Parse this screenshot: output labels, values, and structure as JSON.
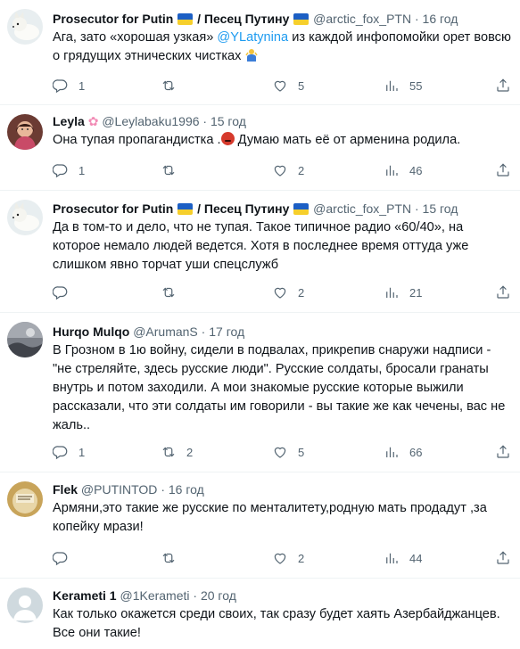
{
  "tweets": [
    {
      "name": "Prosecutor for Putin",
      "name_suffix": "/ Песец Путину",
      "handle": "@arctic_fox_PTN",
      "time": "16 год",
      "text_before": "Ага, зато «хорошая узкая» ",
      "mention": "@YLatynina",
      "text_after": "  из каждой инфопомойки орет вовсю о грядущих этнических чистках",
      "replies": "1",
      "retweets": "",
      "likes": "5",
      "views": "55"
    },
    {
      "name": "Leyla",
      "handle": "@Leylabaku1996",
      "time": "15 год",
      "text_before": "Она тупая пропагандистка .",
      "text_after": " Думаю  мать  её от арменина родила.",
      "replies": "1",
      "retweets": "",
      "likes": "2",
      "views": "46"
    },
    {
      "name": "Prosecutor for Putin",
      "name_suffix": "/ Песец Путину",
      "handle": "@arctic_fox_PTN",
      "time": "15 год",
      "text": "Да в том-то и дело, что не тупая. Такое типичное радио «60/40», на которое немало людей ведется. Хотя в последнее время оттуда уже слишком явно торчат уши спецслужб",
      "replies": "",
      "retweets": "",
      "likes": "2",
      "views": "21"
    },
    {
      "name": "Hurqo Mulqo",
      "handle": "@ArumanS",
      "time": "17 год",
      "text": "В Грозном в 1ю войну, сидели в подвалах, прикрепив снаружи надписи - \"не стреляйте, здесь русские люди\". Русские солдаты, бросали гранаты внутрь и потом заходили. А мои знакомые русские которые выжили рассказали, что эти солдаты им говорили - вы такие же как чечены, вас не жаль..",
      "replies": "1",
      "retweets": "2",
      "likes": "5",
      "views": "66"
    },
    {
      "name": "Flek",
      "handle": "@PUTINTOD",
      "time": "16 год",
      "text": "Армяни,это такие же русские по менталитету,родную мать продадут ,за копейку мрази!",
      "replies": "",
      "retweets": "",
      "likes": "2",
      "views": "44"
    },
    {
      "name": "Kerameti 1",
      "handle": "@1Kerameti",
      "time": "20 год",
      "text": "Как только окажется среди своих, так сразу будет хаять Азербайджанцев. Все они такие!",
      "replies": "",
      "retweets": "",
      "likes": "",
      "views": ""
    }
  ],
  "separator": "·",
  "colors": {
    "text": "#0f1419",
    "muted": "#536471",
    "link": "#1d9bf0",
    "border": "#eff3f4"
  }
}
